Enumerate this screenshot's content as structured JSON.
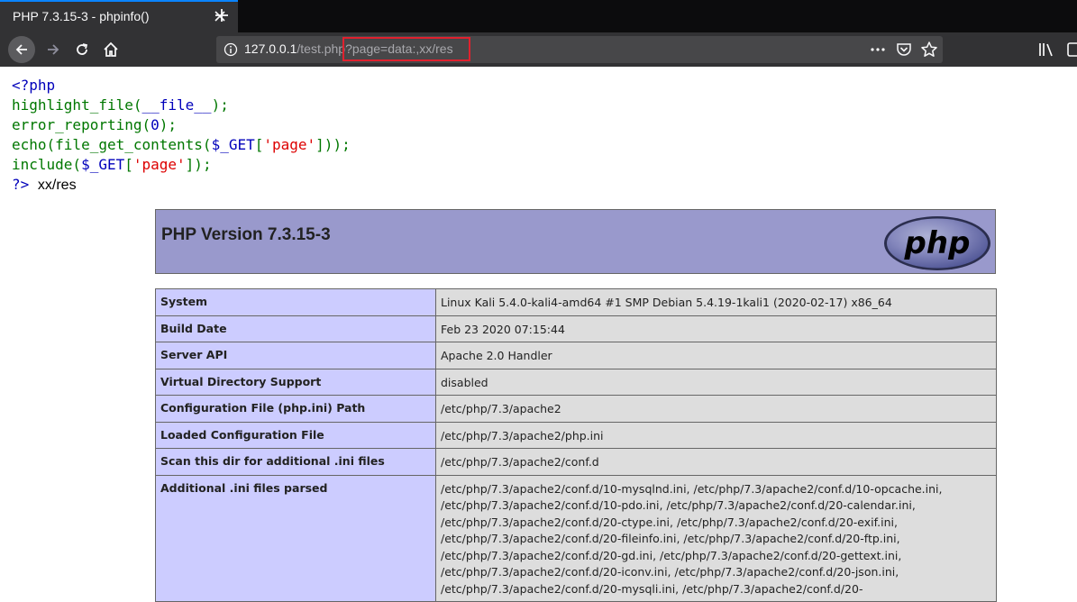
{
  "tab": {
    "title": "PHP 7.3.15-3 - phpinfo()"
  },
  "urlbar": {
    "host": "127.0.0.1",
    "path": "/test.php",
    "query": "?page=data:,xx/res"
  },
  "code": {
    "lines": [
      "<?php",
      "highlight_file(__file__);",
      "error_reporting(0);",
      "echo(file_get_contents($_GET['page']));",
      "include($_GET['page']);",
      "?>"
    ],
    "output": "xx/res"
  },
  "phpinfo": {
    "version": "PHP Version 7.3.15-3",
    "logo_text": "php",
    "rows": [
      {
        "key": "System",
        "value": "Linux Kali 5.4.0-kali4-amd64 #1 SMP Debian 5.4.19-1kali1 (2020-02-17) x86_64"
      },
      {
        "key": "Build Date",
        "value": "Feb 23 2020 07:15:44"
      },
      {
        "key": "Server API",
        "value": "Apache 2.0 Handler"
      },
      {
        "key": "Virtual Directory Support",
        "value": "disabled"
      },
      {
        "key": "Configuration File (php.ini) Path",
        "value": "/etc/php/7.3/apache2"
      },
      {
        "key": "Loaded Configuration File",
        "value": "/etc/php/7.3/apache2/php.ini"
      },
      {
        "key": "Scan this dir for additional .ini files",
        "value": "/etc/php/7.3/apache2/conf.d"
      },
      {
        "key": "Additional .ini files parsed",
        "value": "/etc/php/7.3/apache2/conf.d/10-mysqlnd.ini, /etc/php/7.3/apache2/conf.d/10-opcache.ini, /etc/php/7.3/apache2/conf.d/10-pdo.ini, /etc/php/7.3/apache2/conf.d/20-calendar.ini, /etc/php/7.3/apache2/conf.d/20-ctype.ini, /etc/php/7.3/apache2/conf.d/20-exif.ini, /etc/php/7.3/apache2/conf.d/20-fileinfo.ini, /etc/php/7.3/apache2/conf.d/20-ftp.ini, /etc/php/7.3/apache2/conf.d/20-gd.ini, /etc/php/7.3/apache2/conf.d/20-gettext.ini, /etc/php/7.3/apache2/conf.d/20-iconv.ini, /etc/php/7.3/apache2/conf.d/20-json.ini, /etc/php/7.3/apache2/conf.d/20-mysqli.ini, /etc/php/7.3/apache2/conf.d/20-"
      }
    ]
  },
  "colors": {
    "accent": "#0a84ff",
    "highlight_box": "#e0212e",
    "header_bg": "#9999cc",
    "key_bg": "#ccccff",
    "value_bg": "#dddddd"
  }
}
